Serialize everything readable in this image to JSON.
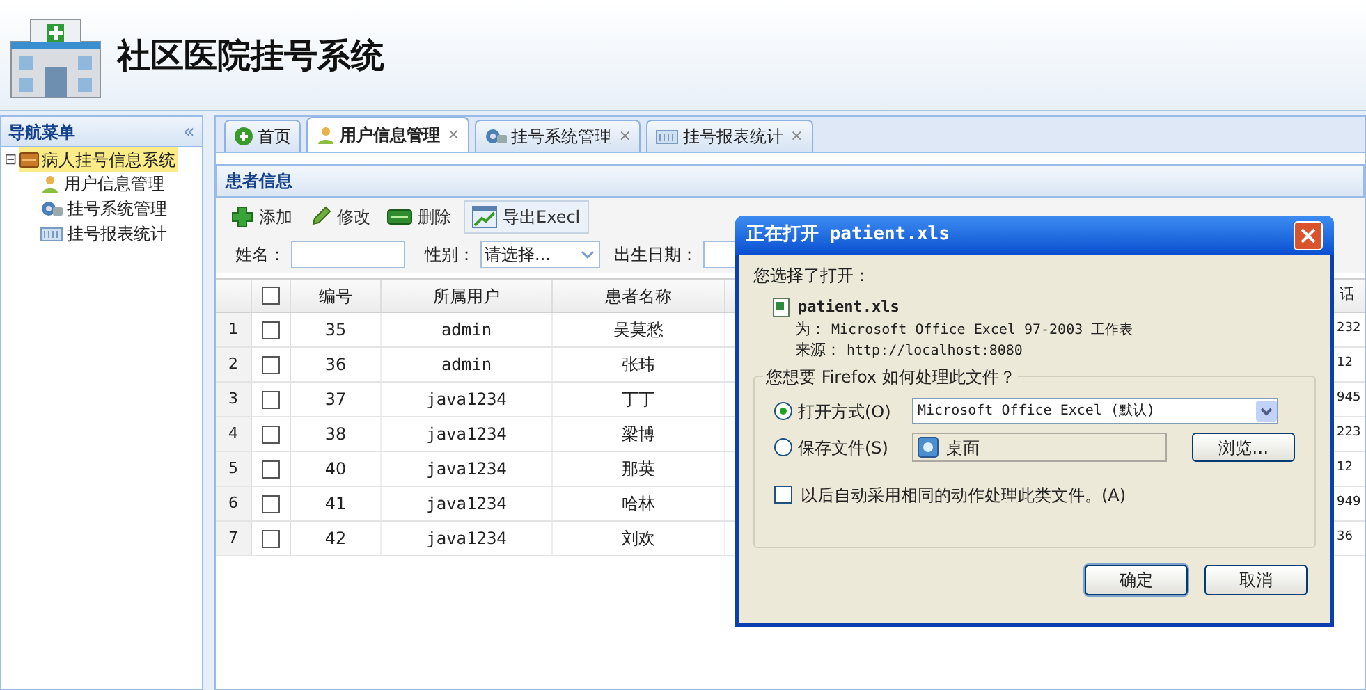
{
  "header": {
    "title": "社区医院挂号系统"
  },
  "nav": {
    "title": "导航菜单",
    "collapse": "«",
    "tree": [
      {
        "label": "病人挂号信息系统",
        "expanded": true,
        "selected": true,
        "expander": "⊟",
        "children": [
          {
            "label": "用户信息管理",
            "kind": "user",
            "selected": false
          },
          {
            "label": "挂号系统管理",
            "kind": "gear",
            "selected": false
          },
          {
            "label": "挂号报表统计",
            "kind": "report",
            "selected": false
          }
        ]
      }
    ]
  },
  "tabs": [
    {
      "label": "首页",
      "kind": "home",
      "selected": false
    },
    {
      "label": "用户信息管理",
      "kind": "user",
      "selected": true,
      "close": "×"
    },
    {
      "label": "挂号系统管理",
      "kind": "gear",
      "selected": false,
      "close": "×"
    },
    {
      "label": "挂号报表统计",
      "kind": "report",
      "selected": false,
      "close": "×"
    }
  ],
  "panel": {
    "title": "患者信息",
    "toolbar": [
      {
        "label": "添加",
        "kind": "add"
      },
      {
        "label": "修改",
        "kind": "edit"
      },
      {
        "label": "删除",
        "kind": "delete"
      },
      {
        "label": "导出Execl",
        "kind": "export"
      }
    ],
    "filters": [
      {
        "label": "姓名：",
        "kind": "text"
      },
      {
        "label": "性别：",
        "kind": "select",
        "value": "请选择..."
      },
      {
        "label": "出生日期：",
        "kind": "text"
      }
    ],
    "table": {
      "columns": [
        "编号",
        "所属用户",
        "患者名称"
      ],
      "column_last": "话",
      "header_checked": false,
      "rows": [
        {
          "index": "1",
          "checked": false,
          "cells": [
            "35",
            "admin",
            "吴莫愁"
          ],
          "last": "232"
        },
        {
          "index": "2",
          "checked": false,
          "cells": [
            "36",
            "admin",
            "张玮"
          ],
          "last": "12"
        },
        {
          "index": "3",
          "checked": false,
          "cells": [
            "37",
            "java1234",
            "丁丁"
          ],
          "last": "945"
        },
        {
          "index": "4",
          "checked": false,
          "cells": [
            "38",
            "java1234",
            "梁博"
          ],
          "last": "223"
        },
        {
          "index": "5",
          "checked": false,
          "cells": [
            "40",
            "java1234",
            "那英"
          ],
          "last": "12"
        },
        {
          "index": "6",
          "checked": false,
          "cells": [
            "41",
            "java1234",
            "哈林"
          ],
          "last": "949"
        },
        {
          "index": "7",
          "checked": false,
          "cells": [
            "42",
            "java1234",
            "刘欢"
          ],
          "last": "36"
        }
      ]
    }
  },
  "dialog": {
    "title": "正在打开 patient.xls",
    "intro": "您选择了打开：",
    "file_name": "patient.xls",
    "type_label": "为：",
    "type_value": "Microsoft Office Excel 97-2003 工作表",
    "source_label": "来源：",
    "source_value": "http://localhost:8080",
    "group_title": "您想要 Firefox 如何处理此文件？",
    "options": [
      {
        "label": "打开方式(O)",
        "selected": true,
        "kind": "select",
        "value": "Microsoft Office Excel (默认)"
      },
      {
        "label": "保存文件(S)",
        "selected": false,
        "kind": "folder",
        "value": "桌面",
        "button": "浏览…"
      }
    ],
    "remember": {
      "label": "以后自动采用相同的动作处理此类文件。(A)",
      "checked": false
    },
    "buttons": [
      "确定",
      "取消"
    ]
  }
}
